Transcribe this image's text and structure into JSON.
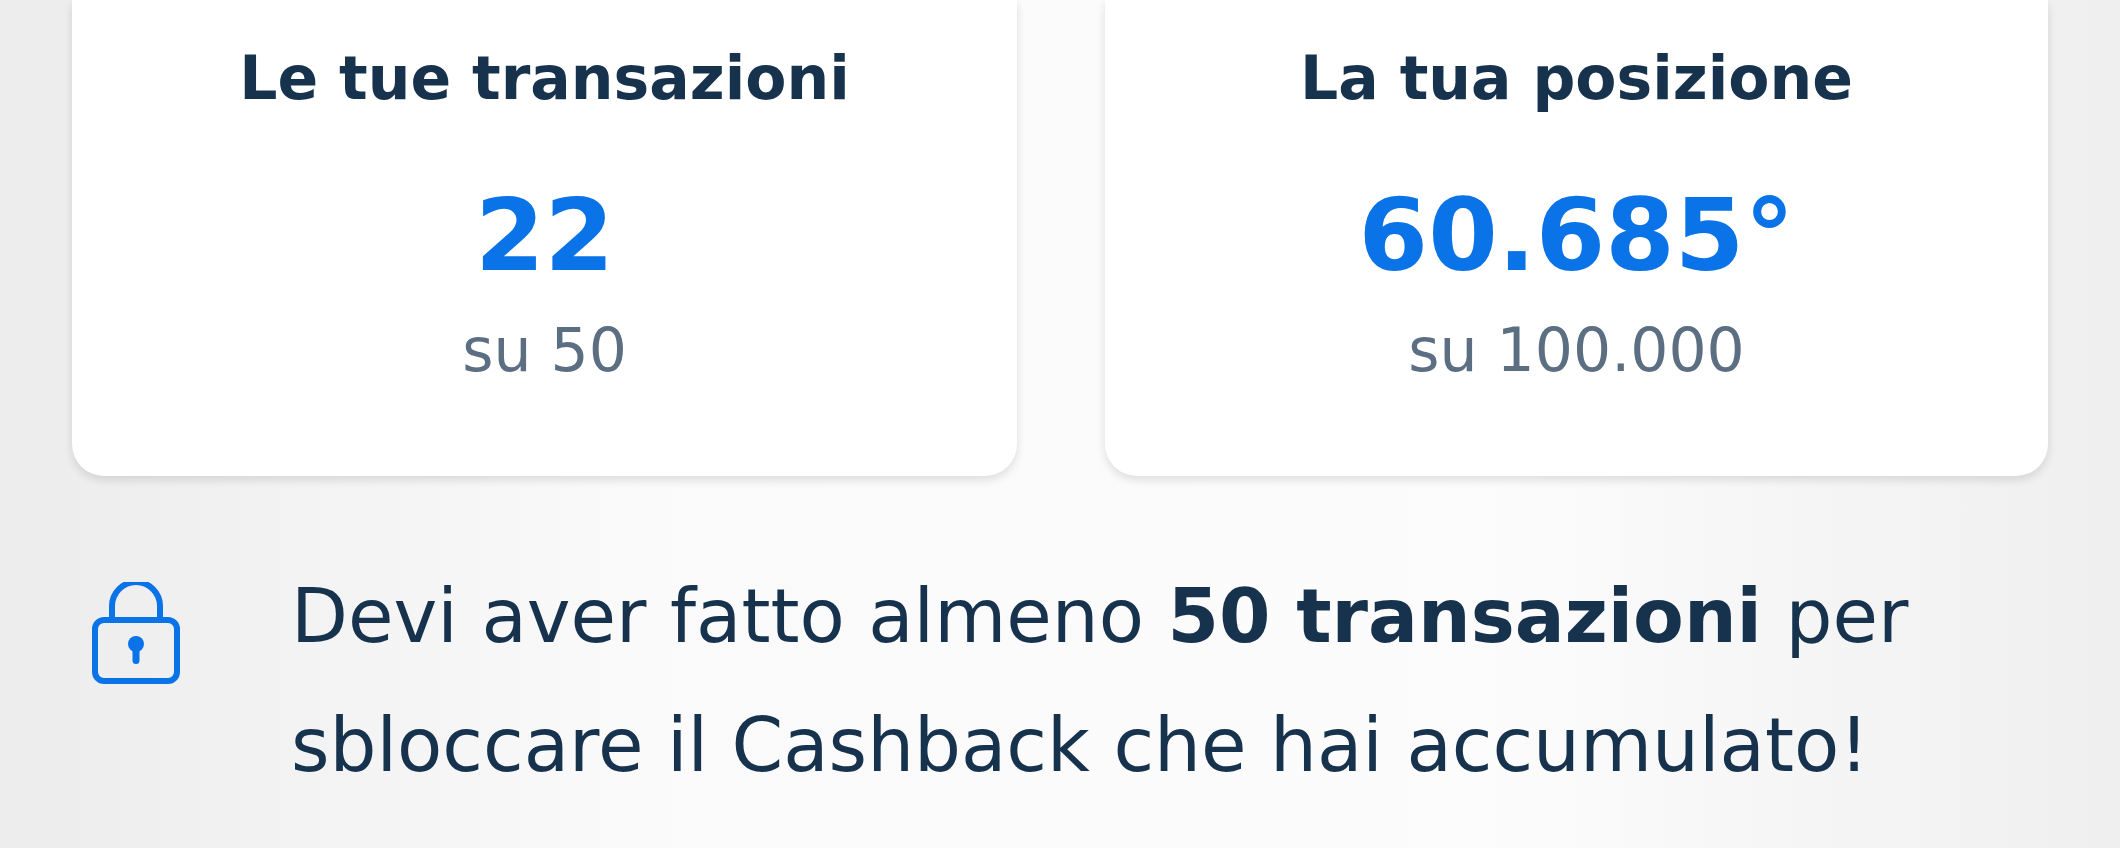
{
  "stats": [
    {
      "title": "Le tue transazioni",
      "value": "22",
      "total": "su 50"
    },
    {
      "title": "La tua posizione",
      "value": "60.685°",
      "total": "su 100.000"
    }
  ],
  "notice": {
    "text": "Devi aver fatto almeno **50 transazioni** per sbloccare il Cashback che hai accumulato!"
  }
}
